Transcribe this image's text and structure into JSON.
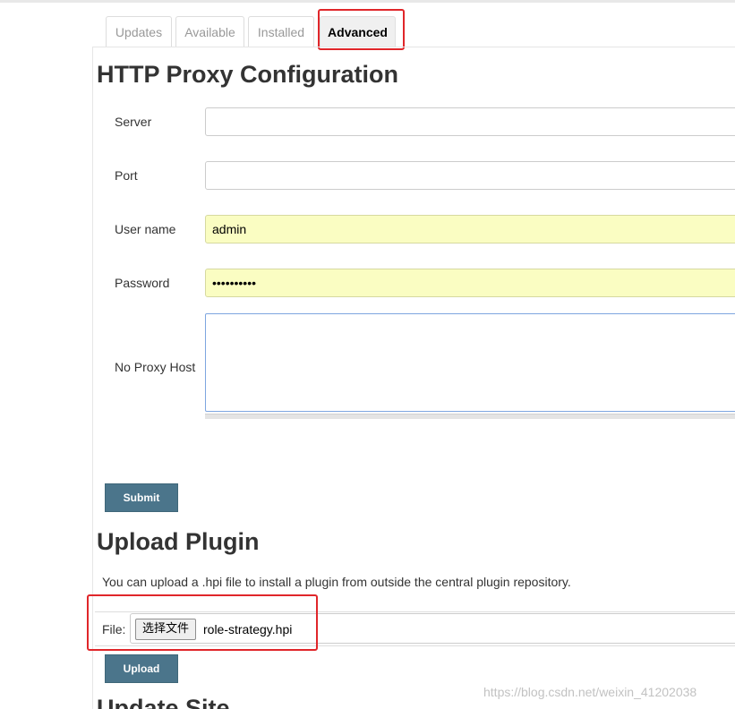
{
  "tabs": [
    {
      "label": "Updates",
      "active": false
    },
    {
      "label": "Available",
      "active": false
    },
    {
      "label": "Installed",
      "active": false
    },
    {
      "label": "Advanced",
      "active": true
    }
  ],
  "proxy": {
    "heading": "HTTP Proxy Configuration",
    "fields": [
      {
        "label": "Server",
        "value": ""
      },
      {
        "label": "Port",
        "value": ""
      },
      {
        "label": "User name",
        "value": "admin"
      },
      {
        "label": "Password",
        "value": "••••••••••"
      },
      {
        "label": "No Proxy Host",
        "value": ""
      }
    ],
    "submit_label": "Submit"
  },
  "upload": {
    "heading": "Upload Plugin",
    "description": "You can upload a .hpi file to install a plugin from outside the central plugin repository.",
    "file_label": "File:",
    "choose_button": "选择文件",
    "file_name": "role-strategy.hpi",
    "upload_label": "Upload"
  },
  "next_heading_partial": "Update Site",
  "watermark": "https://blog.csdn.net/weixin_41202038",
  "colors": {
    "button_bg": "#4b758b",
    "autofill_bg": "#fafdc2",
    "highlight_box": "#e0262a"
  }
}
